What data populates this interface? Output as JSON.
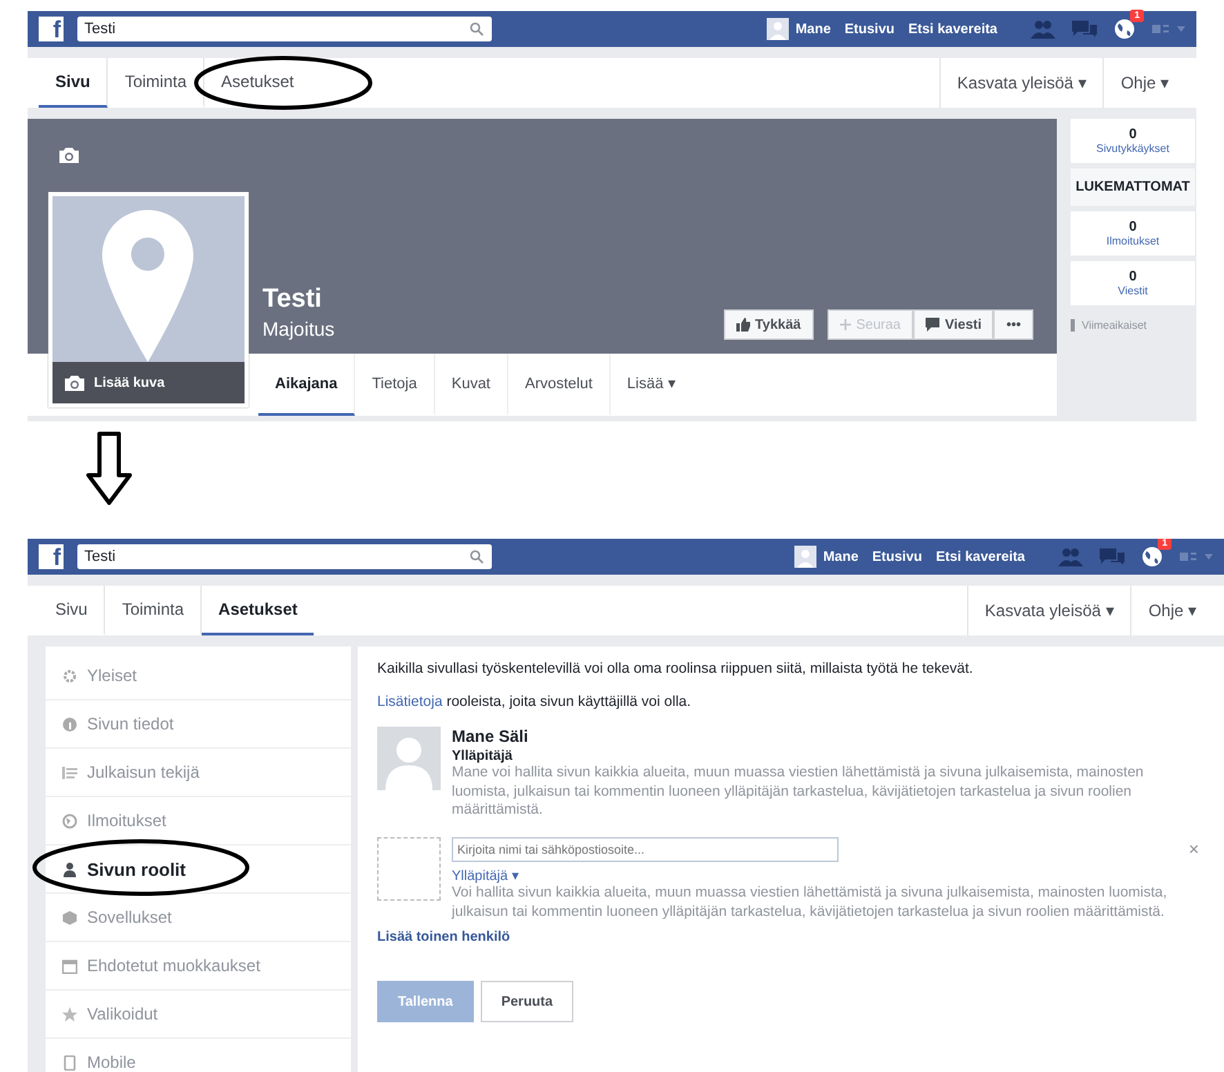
{
  "before": {
    "topbar": {
      "logo": "f",
      "search": "Testi",
      "user": "Mane",
      "links": [
        "Etusivu",
        "Etsi kavereita"
      ],
      "badge": "1"
    },
    "page_tabs": [
      {
        "label": "Sivu",
        "selected": true
      },
      {
        "label": "Toiminta",
        "selected": false
      },
      {
        "label": "Asetukset",
        "selected": false
      }
    ],
    "right_menus": [
      "Kasvata yleisöä ▾",
      "Ohje ▾"
    ],
    "cover": {
      "name": "Testi",
      "category": "Majoitus",
      "add_photo": "Lisää kuva",
      "actions": [
        {
          "kind": "like",
          "label": "Tykkää",
          "disabled": false
        },
        {
          "kind": "follow",
          "label": "Seuraa",
          "disabled": true
        },
        {
          "kind": "message",
          "label": "Viesti",
          "disabled": false
        },
        {
          "kind": "more",
          "label": "•••",
          "disabled": false
        }
      ],
      "tabs": [
        {
          "label": "Aikajana",
          "selected": true
        },
        {
          "label": "Tietoja",
          "selected": false
        },
        {
          "label": "Kuvat",
          "selected": false
        },
        {
          "label": "Arvostelut",
          "selected": false
        },
        {
          "label": "Lisää ▾",
          "selected": false
        }
      ]
    },
    "stats": [
      {
        "value": "0",
        "label": "Sivutykkäykset"
      }
    ],
    "unread_header": "LUKEMATTOMAT",
    "unread": [
      {
        "value": "0",
        "label": "Ilmoitukset"
      },
      {
        "value": "0",
        "label": "Viestit"
      }
    ],
    "recent": "Viimeaikaiset"
  },
  "after": {
    "topbar": {
      "logo": "f",
      "search": "Testi",
      "user": "Mane",
      "links": [
        "Etusivu",
        "Etsi kavereita"
      ],
      "badge": "1"
    },
    "page_tabs": [
      {
        "label": "Sivu",
        "selected": false
      },
      {
        "label": "Toiminta",
        "selected": false
      },
      {
        "label": "Asetukset",
        "selected": true
      }
    ],
    "right_menus": [
      "Kasvata yleisöä ▾",
      "Ohje ▾"
    ],
    "settings_menu": [
      {
        "label": "Yleiset",
        "selected": false
      },
      {
        "label": "Sivun tiedot",
        "selected": false
      },
      {
        "label": "Julkaisun tekijä",
        "selected": false
      },
      {
        "label": "Ilmoitukset",
        "selected": false
      },
      {
        "label": "Sivun roolit",
        "selected": true
      },
      {
        "label": "Sovellukset",
        "selected": false
      },
      {
        "label": "Ehdotetut muokkaukset",
        "selected": false
      },
      {
        "label": "Valikoidut",
        "selected": false
      },
      {
        "label": "Mobile",
        "selected": false
      }
    ],
    "roles": {
      "intro": "Kaikilla sivullasi työskentelevillä voi olla oma roolinsa riippuen siitä, millaista työtä he tekevät.",
      "more_link": "Lisätietoja",
      "more_text": " rooleista, joita sivun käyttäjillä voi olla.",
      "admin": {
        "name": "Mane Säli",
        "role": "Ylläpitäjä",
        "description": "Mane voi hallita sivun kaikkia alueita, muun muassa viestien lähettämistä ja sivuna julkaisemista, mainosten luomista, julkaisun tai kommentin luoneen ylläpitäjän tarkastelua, kävijätietojen tarkastelua ja sivun roolien määrittämistä."
      },
      "new_person": {
        "placeholder": "Kirjoita nimi tai sähköpostiosoite...",
        "role": "Ylläpitäjä ▾",
        "description": "Voi hallita sivun kaikkia alueita, muun muassa viestien lähettämistä ja sivuna julkaisemista, mainosten luomista, julkaisun tai kommentin luoneen ylläpitäjän tarkastelua, kävijätietojen tarkastelua ja sivun roolien määrittämistä.",
        "remove": "×"
      },
      "add_person": "Lisää toinen henkilö",
      "buttons": [
        {
          "kind": "primary",
          "label": "Tallenna",
          "disabled": true
        },
        {
          "kind": "secondary",
          "label": "Peruuta",
          "disabled": false
        }
      ]
    }
  }
}
